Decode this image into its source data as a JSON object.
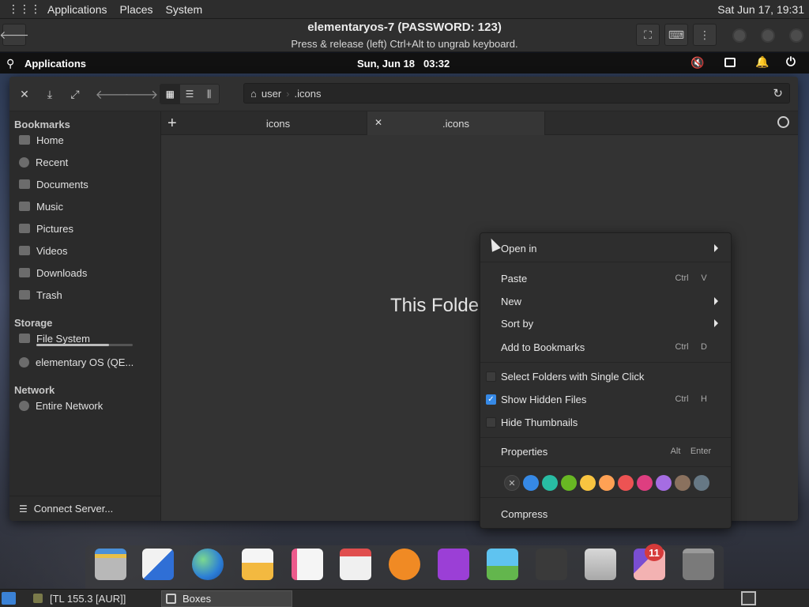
{
  "host": {
    "menus": [
      "Applications",
      "Places",
      "System"
    ],
    "clock": "Sat Jun 17, 19:31"
  },
  "boxes": {
    "title": "elementaryos-7 (PASSWORD: 123)",
    "hint": "Press & release (left) Ctrl+Alt to ungrab keyboard."
  },
  "guest_panel": {
    "applications": "Applications",
    "date": "Sun, Jun 18",
    "time": "03:32"
  },
  "files": {
    "path": [
      "user",
      ".icons"
    ],
    "sidebar": {
      "bookmarks_header": "Bookmarks",
      "bookmarks": [
        "Home",
        "Recent",
        "Documents",
        "Music",
        "Pictures",
        "Videos",
        "Downloads",
        "Trash"
      ],
      "storage_header": "Storage",
      "storage": [
        "File System",
        "elementary OS (QE..."
      ],
      "network_header": "Network",
      "network": [
        "Entire Network"
      ],
      "connect_server": "Connect Server...",
      "file_system_usage": 0.75
    },
    "tabs": [
      "icons",
      ".icons"
    ],
    "empty_message": "This Folde"
  },
  "context_menu": {
    "open_in": "Open in",
    "paste": "Paste",
    "paste_keys": [
      "Ctrl",
      "V"
    ],
    "new": "New",
    "sort_by": "Sort by",
    "add_bookmarks": "Add to Bookmarks",
    "add_bookmarks_keys": [
      "Ctrl",
      "D"
    ],
    "single_click": "Select Folders with Single Click",
    "show_hidden": "Show Hidden Files",
    "show_hidden_keys": [
      "Ctrl",
      "H"
    ],
    "hide_thumbnails": "Hide Thumbnails",
    "properties": "Properties",
    "properties_keys": [
      "Alt",
      "Enter"
    ],
    "compress": "Compress",
    "show_hidden_checked": true,
    "colors": [
      "#3689e6",
      "#28bca3",
      "#68b723",
      "#f9c440",
      "#ffa154",
      "#ed5353",
      "#de3e80",
      "#a56de2",
      "#8a715e",
      "#667885"
    ]
  },
  "dock": {
    "badge": "11",
    "apps": [
      "files-app-icon",
      "multitasking-app-icon",
      "browser-app-icon",
      "mail-app-icon",
      "tasks-app-icon",
      "calendar-app-icon",
      "music-app-icon",
      "videos-app-icon",
      "photos-app-icon",
      "terminal-app-icon",
      "settings-app-icon",
      "appcenter-app-icon",
      "trash-app-icon"
    ]
  },
  "host_bottom": {
    "terminal_item": "[TL 155.3 [AUR]]",
    "boxes_item": "Boxes"
  }
}
